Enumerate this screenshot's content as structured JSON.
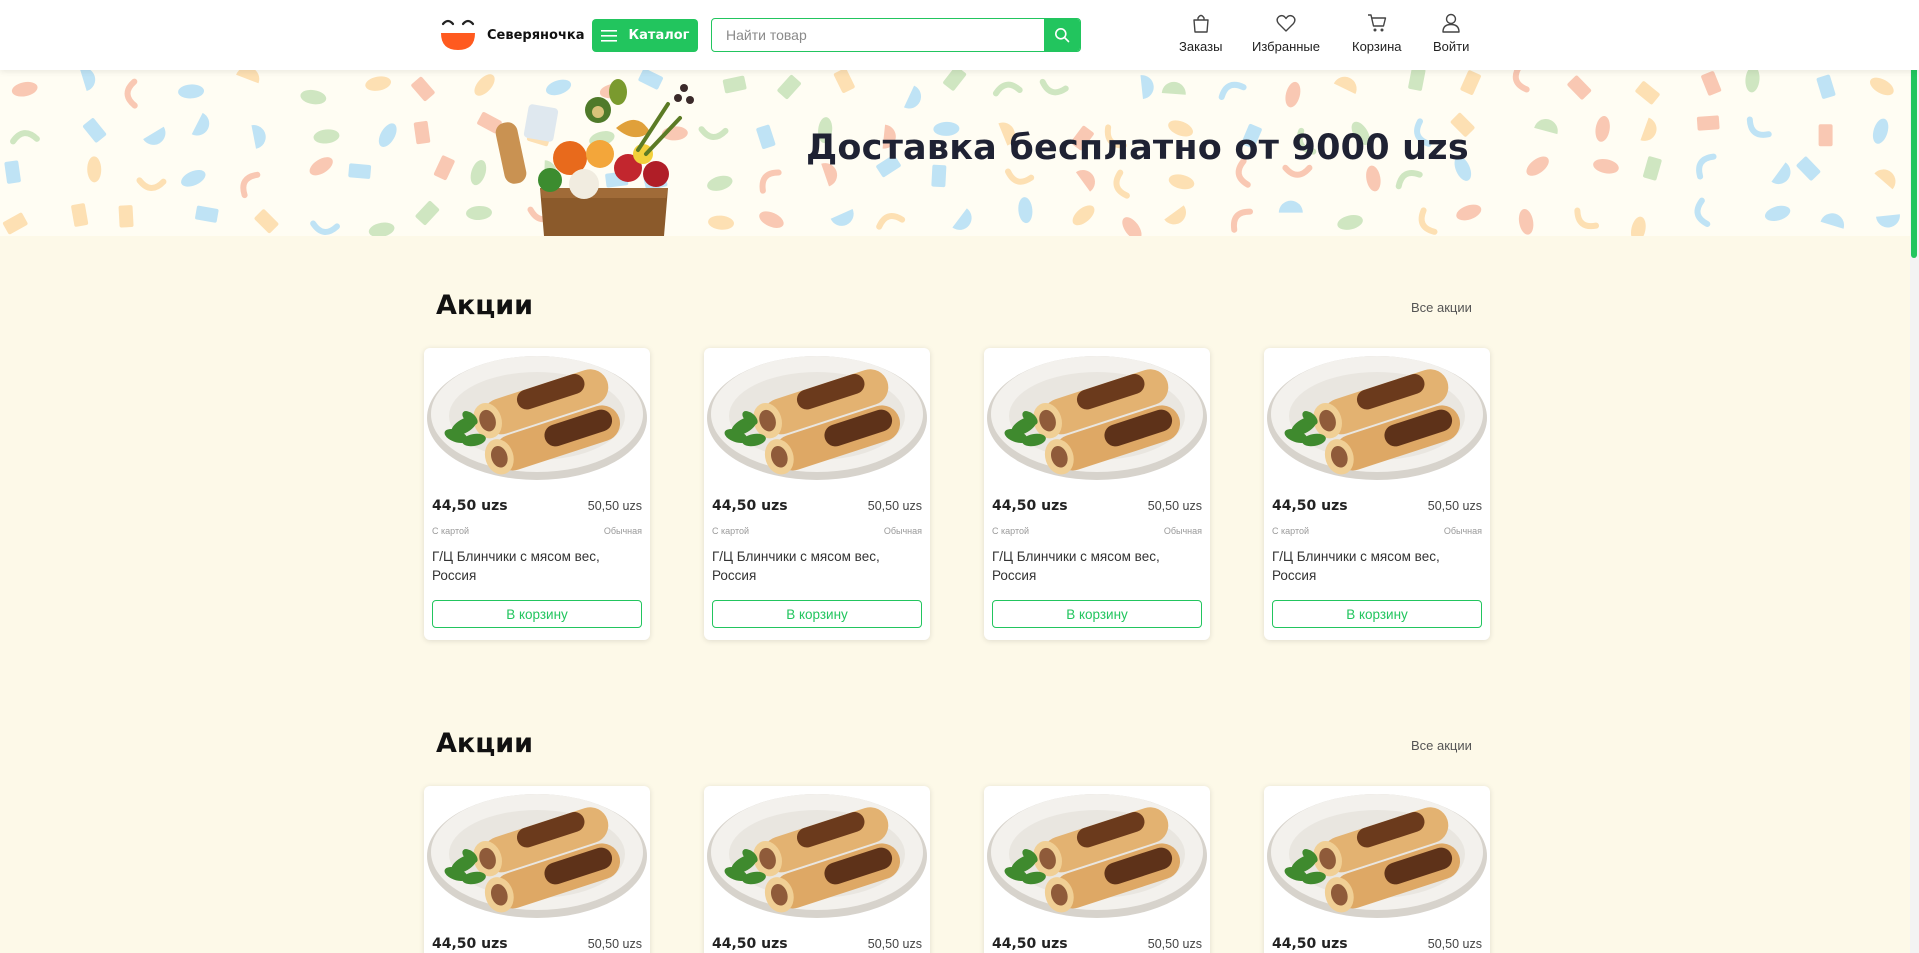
{
  "header": {
    "logo_text": "Северяночка",
    "catalog_label": "Каталог",
    "search_placeholder": "Найти товар",
    "nav": {
      "orders": "Заказы",
      "favorites": "Избранные",
      "cart": "Корзина",
      "login": "Войти"
    }
  },
  "banner": {
    "title": "Доставка бесплатно от 9000 uzs"
  },
  "colors": {
    "accent": "#22c55e",
    "page_bg": "#fdf9e8",
    "title": "#1f2233"
  },
  "sections": [
    {
      "title": "Акции",
      "see_all": "Все акции",
      "products": [
        {
          "price": "44,50 uzs",
          "old_price": "50,50 uzs",
          "card_label": "С картой",
          "regular_label": "Обычная",
          "name": "Г/Ц Блинчики с мясом вес, Россия",
          "button": "В корзину"
        },
        {
          "price": "44,50 uzs",
          "old_price": "50,50 uzs",
          "card_label": "С картой",
          "regular_label": "Обычная",
          "name": "Г/Ц Блинчики с мясом вес, Россия",
          "button": "В корзину"
        },
        {
          "price": "44,50 uzs",
          "old_price": "50,50 uzs",
          "card_label": "С картой",
          "regular_label": "Обычная",
          "name": "Г/Ц Блинчики с мясом вес, Россия",
          "button": "В корзину"
        },
        {
          "price": "44,50 uzs",
          "old_price": "50,50 uzs",
          "card_label": "С картой",
          "regular_label": "Обычная",
          "name": "Г/Ц Блинчики с мясом вес, Россия",
          "button": "В корзину"
        }
      ]
    },
    {
      "title": "Акции",
      "see_all": "Все акции",
      "products": [
        {
          "price": "44,50 uzs",
          "old_price": "50,50 uzs"
        },
        {
          "price": "44,50 uzs",
          "old_price": "50,50 uzs"
        },
        {
          "price": "44,50 uzs",
          "old_price": "50,50 uzs"
        },
        {
          "price": "44,50 uzs",
          "old_price": "50,50 uzs"
        }
      ]
    }
  ]
}
